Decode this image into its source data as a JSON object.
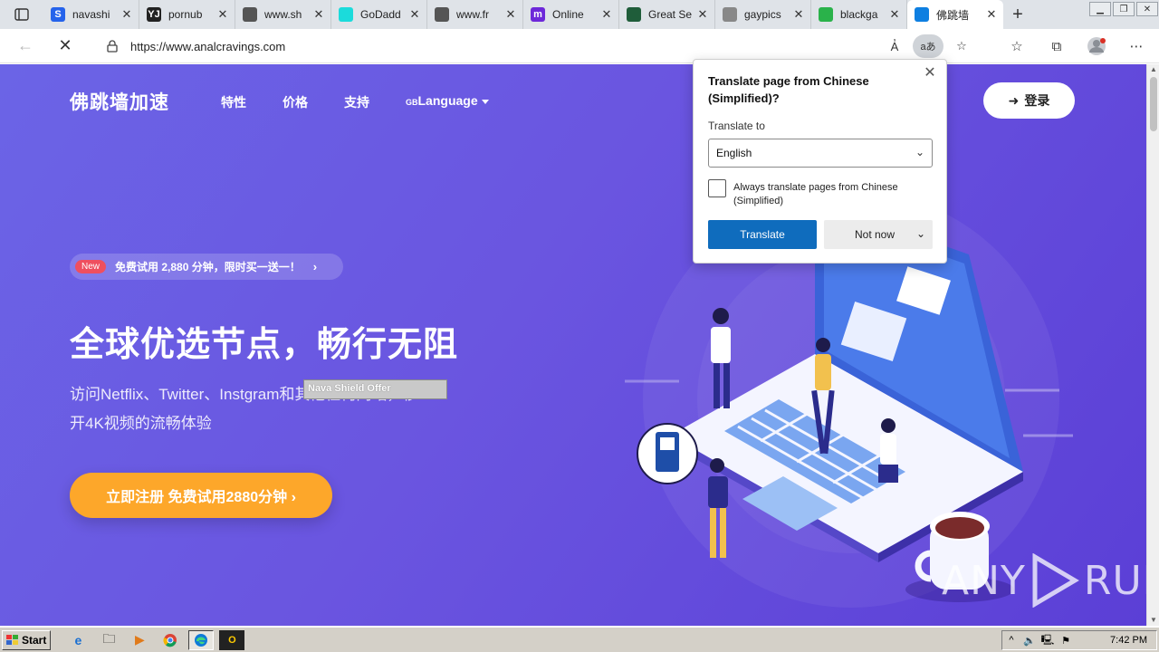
{
  "browser": {
    "tabs": [
      {
        "title": "navashi",
        "favicon": "S",
        "color": "#2563eb"
      },
      {
        "title": "pornub",
        "favicon": "YJ",
        "color": "#222222"
      },
      {
        "title": "www.sh",
        "favicon": "",
        "color": "#555555"
      },
      {
        "title": "GoDadd",
        "favicon": "",
        "color": "#1bdbdb"
      },
      {
        "title": "www.fr",
        "favicon": "",
        "color": "#555555"
      },
      {
        "title": "Online",
        "favicon": "m",
        "color": "#6d28d9"
      },
      {
        "title": "Great Se",
        "favicon": "",
        "color": "#1f5d3a"
      },
      {
        "title": "gaypics",
        "favicon": "",
        "color": "#888888"
      },
      {
        "title": "blackga",
        "favicon": "",
        "color": "#2ab24a"
      },
      {
        "title": "佛跳墙",
        "favicon": "",
        "color": "#0e7fe1"
      }
    ],
    "url": "https://www.analcravings.com",
    "translate_icon_label": "aあ"
  },
  "site": {
    "brand": "佛跳墙加速",
    "nav": [
      "特性",
      "价格",
      "支持",
      "Language"
    ],
    "lang_prefix": "GB",
    "login": "登录",
    "promo_badge": "New",
    "promo_text": "免费试用 2,880 分钟，限时买一送一！",
    "hero_title": "全球优选节点，畅行无阻",
    "hero_sub_1": "访问Netflix、Twitter、Instgram和",
    "hero_sub_hidden": "其他任何网",
    "hero_sub_2": "站，秒",
    "hero_sub_3": "开4K视频的流畅体验",
    "cta": "立即注册 免费试用2880分钟 ›",
    "overlay": "Nava Shield Offer"
  },
  "translate_popup": {
    "title": "Translate page from Chinese (Simplified)?",
    "label": "Translate to",
    "selected_language": "English",
    "checkbox_label": "Always translate pages from Chinese (Simplified)",
    "translate_button": "Translate",
    "not_now_button": "Not now"
  },
  "watermark": {
    "left": "ANY",
    "right": "RUN"
  },
  "taskbar": {
    "start": "Start",
    "clock": "7:42 PM"
  },
  "colors": {
    "hero_gradient_start": "#6b64e6",
    "hero_gradient_end": "#5b3fd6",
    "cta": "#fda72a",
    "translate_button": "#0f6cbd",
    "new_badge": "#ef4f5f"
  }
}
